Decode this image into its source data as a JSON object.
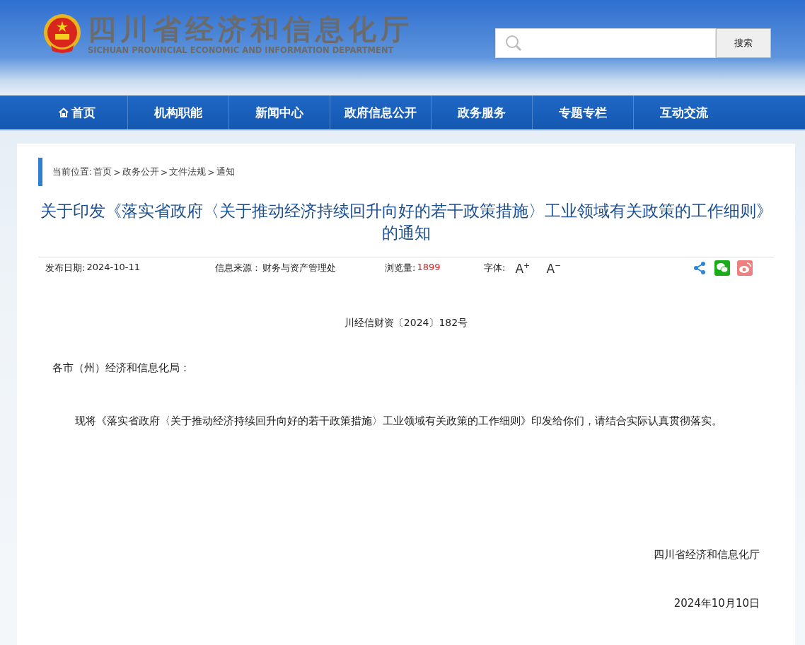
{
  "header": {
    "title": "四川省经济和信息化厅",
    "subtitle": "SICHUAN PROVINCIAL ECONOMIC AND INFORMATION DEPARTMENT",
    "search_button": "搜索"
  },
  "nav": [
    {
      "label": "首页",
      "kind": "home"
    },
    {
      "label": "机构职能",
      "kind": "plain"
    },
    {
      "label": "新闻中心",
      "kind": "plain"
    },
    {
      "label": "政府信息公开",
      "kind": "plain"
    },
    {
      "label": "政务服务",
      "kind": "plain"
    },
    {
      "label": "专题专栏",
      "kind": "plain"
    },
    {
      "label": "互动交流",
      "kind": "plain"
    }
  ],
  "breadcrumb": {
    "label": "当前位置:",
    "separator": ">",
    "items": [
      "首页",
      "政务公开",
      "文件法规",
      "通知"
    ]
  },
  "article": {
    "title": "关于印发《落实省政府〈关于推动经济持续回升向好的若干政策措施〉工业领域有关政策的工作细则》的通知",
    "meta": {
      "date_label": "发布日期:",
      "date": "2024-10-11",
      "source_label": "信息来源：",
      "source": "财务与资产管理处",
      "views_label": "浏览量:",
      "views": "1899",
      "font_label": "字体:",
      "font_larger": "A$^{+}$",
      "font_smaller": "A$^{−}$"
    },
    "doc_number": "川经信财资〔2024〕182号",
    "salutation": "各市（州）经济和信息化局：",
    "body": "现将《落实省政府〈关于推动经济持续回升向好的若干政策措施〉工业领域有关政策的工作细则》印发给你们，请结合实际认真贯彻落实。",
    "signature": "四川省经济和信息化厅",
    "sign_date": "2024年10月10日"
  }
}
